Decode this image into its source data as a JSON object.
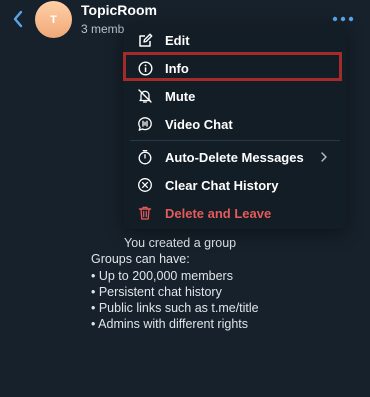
{
  "header": {
    "back_icon": "chevron-left-icon",
    "avatar_letter": "T",
    "title": "TopicRoom",
    "subtitle": "3 memb",
    "more_icon": "ellipsis-horizontal-icon"
  },
  "menu": {
    "items": [
      {
        "label": "Edit",
        "icon": "edit-square-icon"
      },
      {
        "label": "Info",
        "icon": "info-circle-icon"
      },
      {
        "label": "Mute",
        "icon": "bell-off-icon"
      },
      {
        "label": "Video Chat",
        "icon": "video-chat-icon"
      },
      {
        "label": "Auto-Delete Messages",
        "icon": "timer-icon"
      },
      {
        "label": "Clear Chat History",
        "icon": "clear-circle-icon"
      },
      {
        "label": "Delete and Leave",
        "icon": "trash-icon"
      }
    ],
    "highlighted_item": "Info"
  },
  "empty_chat": {
    "heading": "You created a group",
    "intro": "Groups can have:",
    "bullets": [
      "• Up to 200,000 members",
      "• Persistent chat history",
      "• Public links such as t.me/title",
      "• Admins with different rights"
    ]
  },
  "colors": {
    "background": "#17212b",
    "accent": "#5aa6e8",
    "danger": "#e55a5a",
    "highlight_border": "#a52a2a"
  }
}
